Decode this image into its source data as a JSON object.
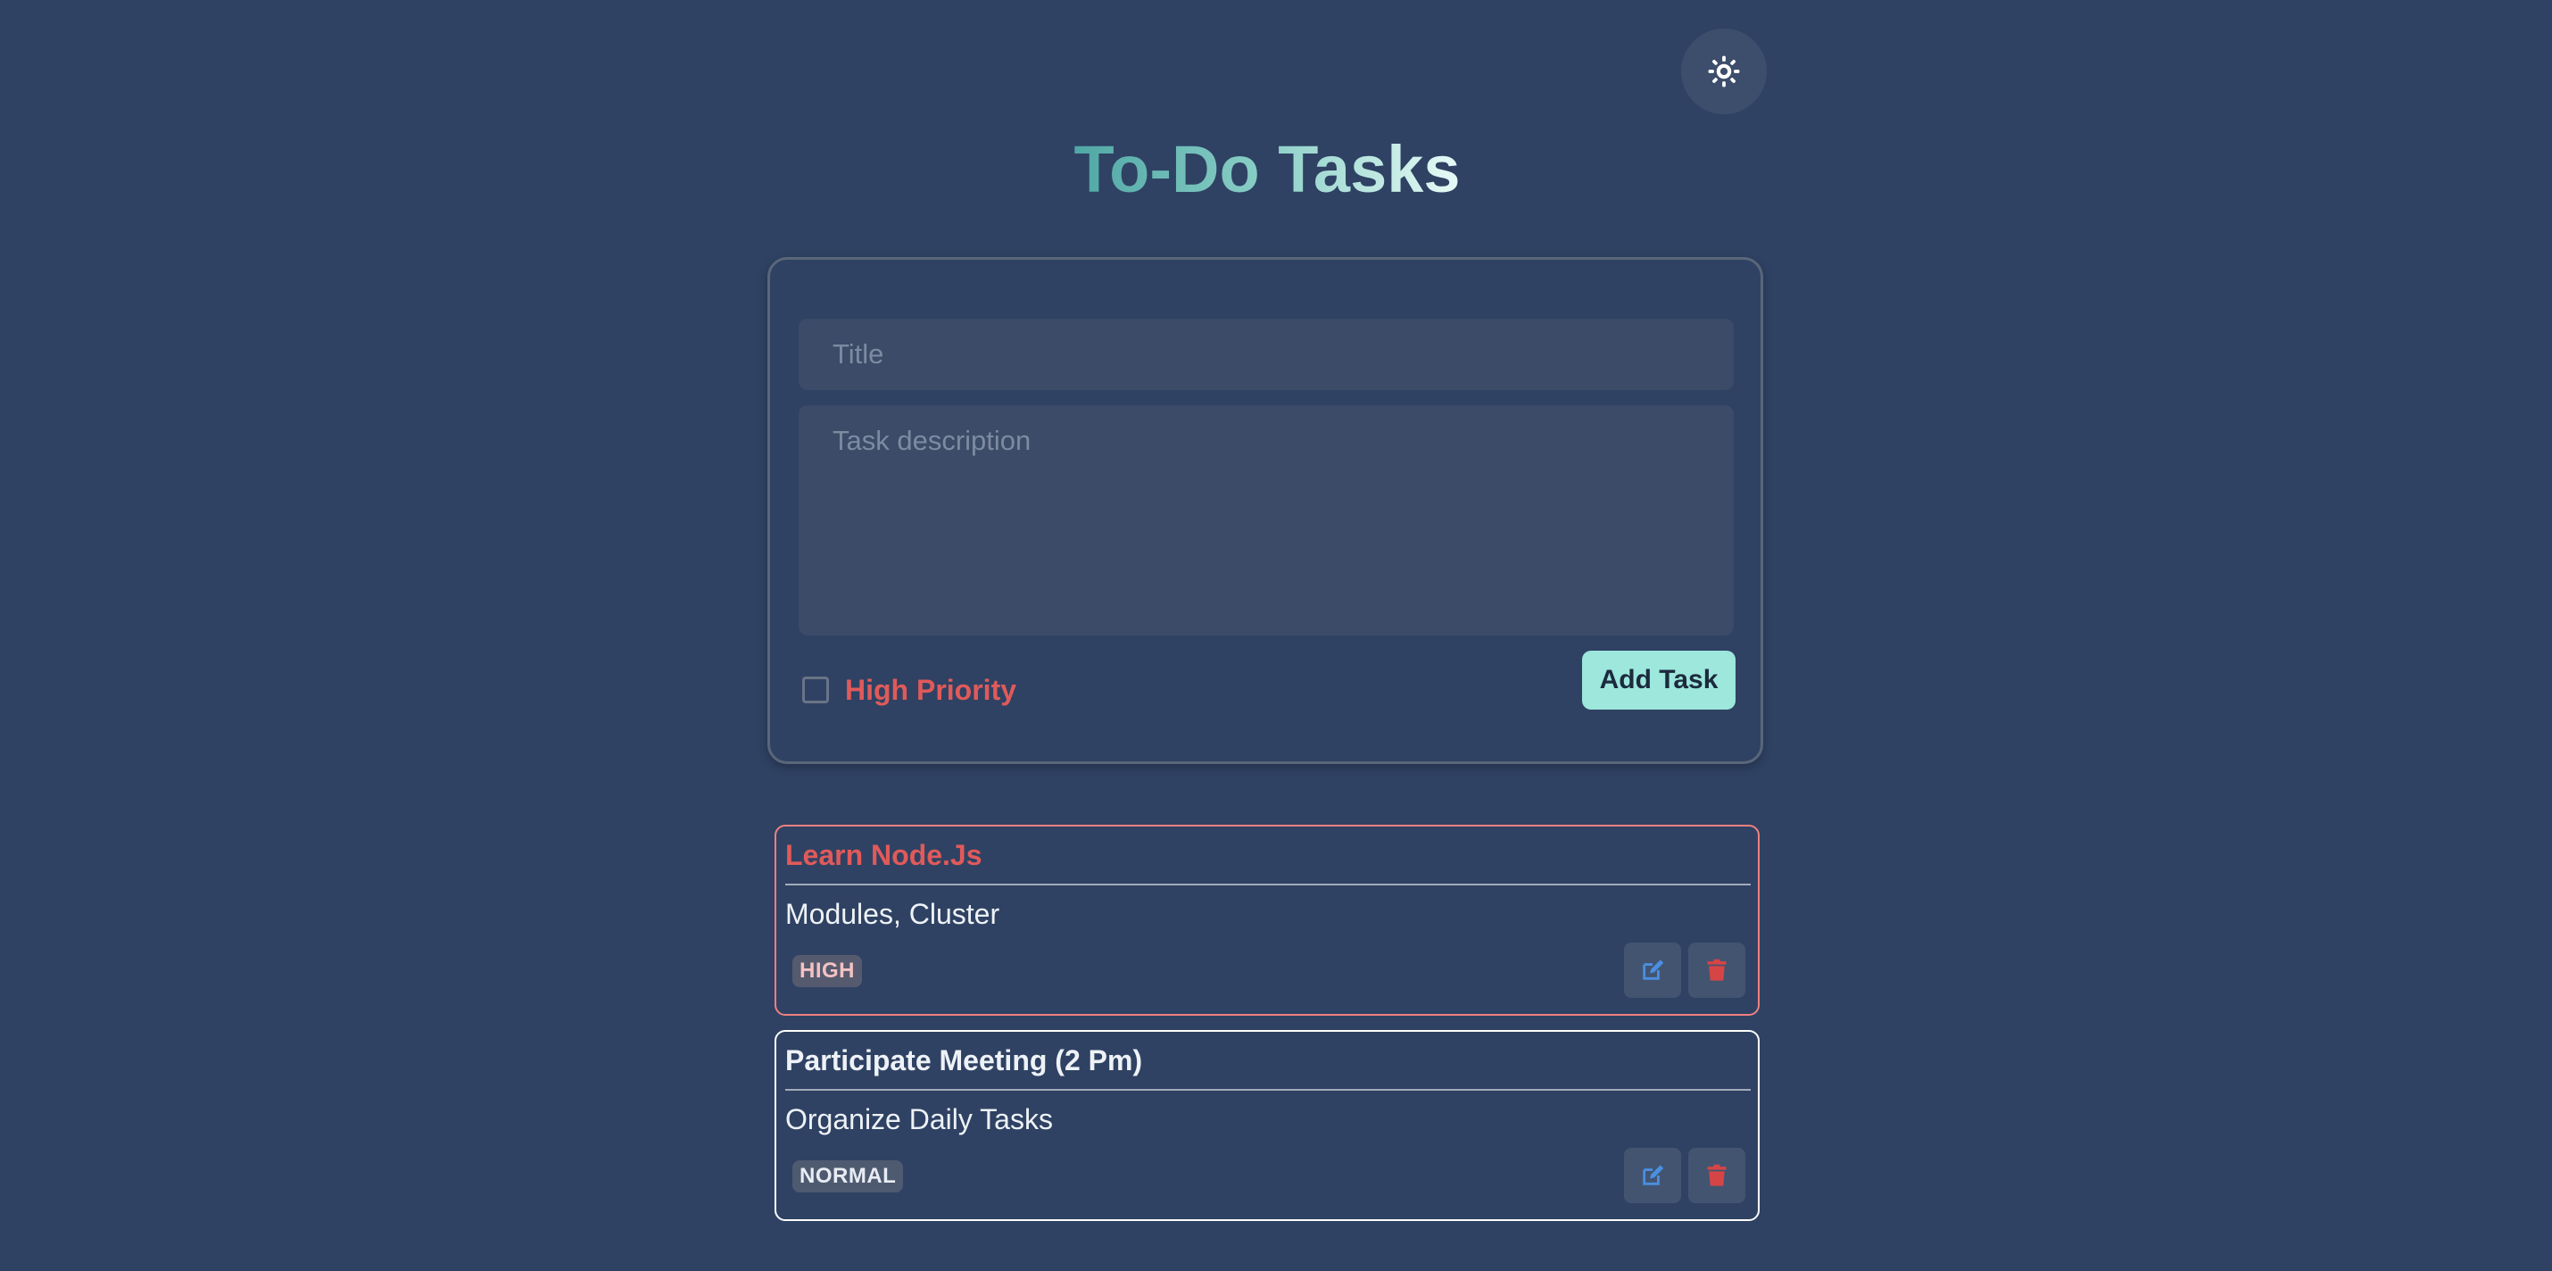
{
  "header": {
    "title": "To-Do Tasks",
    "theme_toggle_icon": "sun-icon"
  },
  "form": {
    "title_placeholder": "Title",
    "title_value": "",
    "description_placeholder": "Task description",
    "description_value": "",
    "priority_label": "High Priority",
    "priority_checked": false,
    "submit_label": "Add Task"
  },
  "tasks": [
    {
      "title": "Learn Node.Js",
      "description": "Modules, Cluster",
      "priority": "HIGH",
      "edit_icon": "edit-icon",
      "delete_icon": "trash-icon"
    },
    {
      "title": "Participate Meeting (2 Pm)",
      "description": "Organize Daily Tasks",
      "priority": "NORMAL",
      "edit_icon": "edit-icon",
      "delete_icon": "trash-icon"
    }
  ],
  "colors": {
    "background": "#2f4263",
    "accent": "#9de7dc",
    "high_priority": "#e05a5a",
    "edit_icon": "#4a8fe0",
    "delete_icon": "#d64545"
  }
}
